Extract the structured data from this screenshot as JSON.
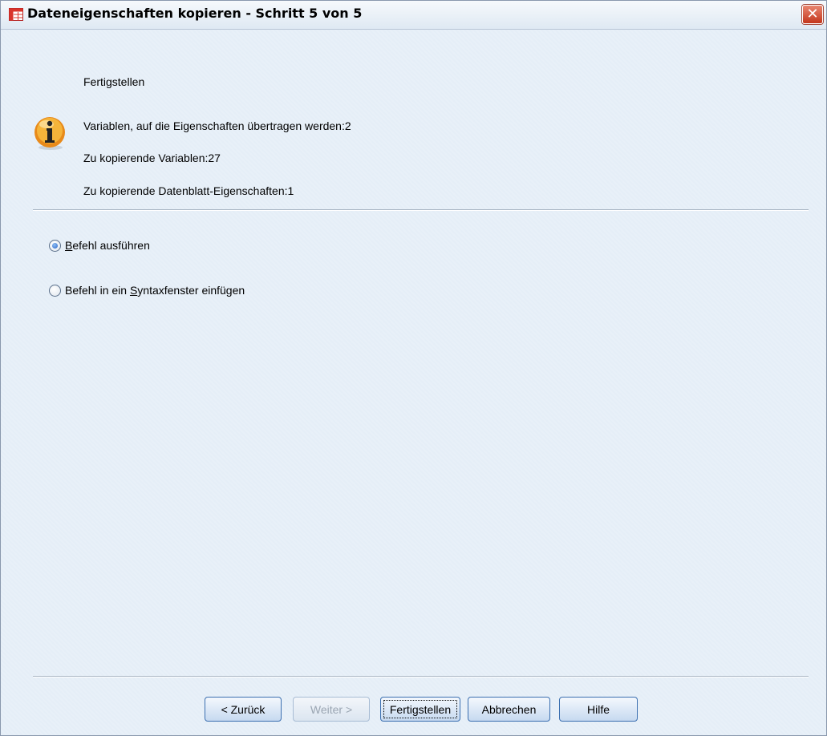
{
  "window": {
    "title": "Dateneigenschaften kopieren - Schritt 5 von 5",
    "close_glyph": "✕",
    "app_icon": "spreadsheet-icon"
  },
  "summary": {
    "heading": "Fertigstellen",
    "info_icon": "info-icon",
    "lines": [
      "Variablen, auf die Eigenschaften übertragen werden:2",
      "Zu kopierende Variablen:27",
      "Zu kopierende Datenblatt-Eigenschaften:1"
    ]
  },
  "options": {
    "selected": "run",
    "run": {
      "mnemonic": "B",
      "rest": "efehl ausführen"
    },
    "paste": {
      "before": "Befehl in ein ",
      "mnemonic": "S",
      "rest": "yntaxfenster einfügen"
    }
  },
  "buttons": {
    "back": "< Zurück",
    "next": "Weiter >",
    "finish": "Fertigstellen",
    "cancel": "Abbrechen",
    "help": "Hilfe"
  },
  "colors": {
    "background": "#e5eef7",
    "button_border": "#3b6fb0",
    "info_orange": "#f0a030"
  }
}
